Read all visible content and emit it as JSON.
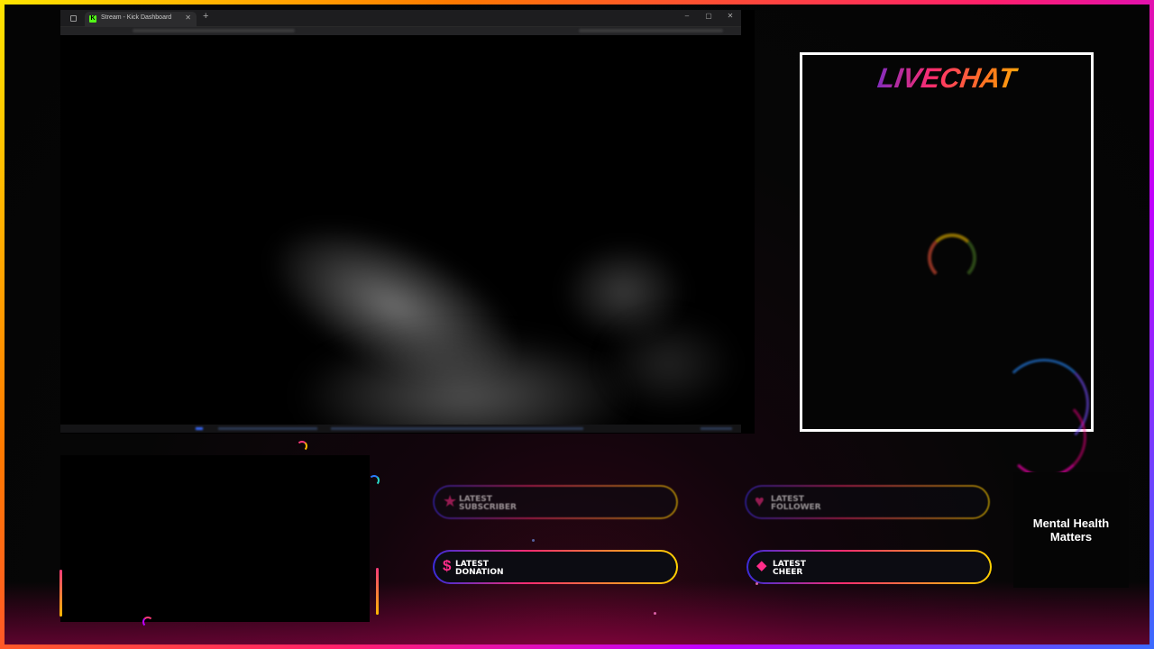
{
  "browser": {
    "tab_title": "Stream - Kick Dashboard",
    "kick_icon": "kick-favicon",
    "window_controls": [
      "–",
      "▢",
      "✕"
    ]
  },
  "chat": {
    "title": "LIVECHAT"
  },
  "alerts": [
    {
      "label": "LATEST\nSUBSCRIBER",
      "icon": "star-icon",
      "glyph": "★"
    },
    {
      "label": "LATEST\nFOLLOWER",
      "icon": "heart-icon",
      "glyph": "♥"
    },
    {
      "label": "LATEST\nDONATION",
      "icon": "dollar-icon",
      "glyph": "$"
    },
    {
      "label": "LATEST\nCHEER",
      "icon": "diamond-icon",
      "glyph": "◆"
    }
  ],
  "mental_health": {
    "text": "Mental Health\nMatters"
  },
  "colors": {
    "frame_gradient": [
      "#ffe600",
      "#ff7a00",
      "#ff1f6b",
      "#c100ff",
      "#3a6bff"
    ],
    "accent_pink": "#ff2d8a",
    "kick_green": "#53fc18"
  }
}
